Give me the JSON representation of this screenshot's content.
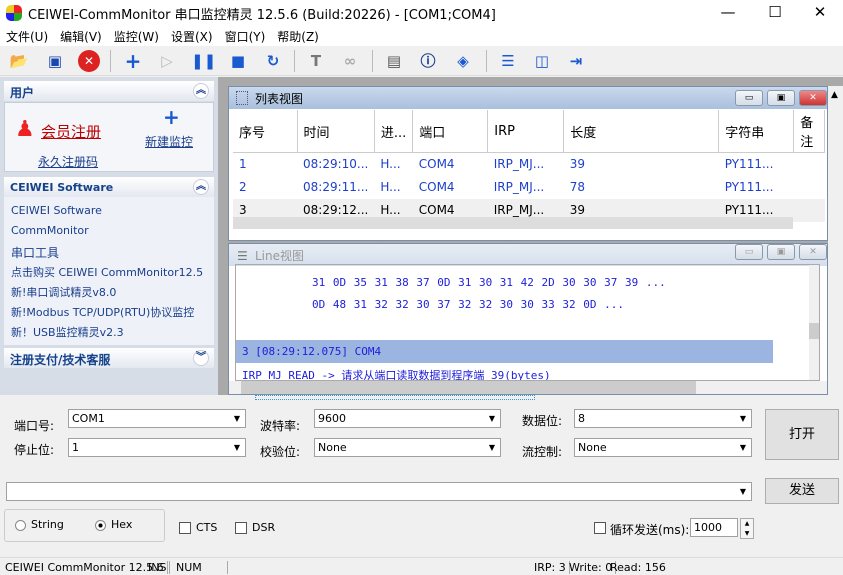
{
  "window": {
    "title": "CEIWEI-CommMonitor 串口监控精灵 12.5.6 (Build:20226) - [COM1;COM4]"
  },
  "menu": [
    "文件(U)",
    "编辑(V)",
    "监控(W)",
    "设置(X)",
    "窗口(Y)",
    "帮助(Z)"
  ],
  "toolbar": [
    "open-icon",
    "save-icon",
    "close-red-icon",
    "add-icon",
    "play-icon",
    "pause-icon",
    "stop-icon",
    "refresh-icon",
    "hammer-icon",
    "binoculars-icon",
    "device-icon",
    "info-icon",
    "book-icon",
    "split-horizontal-icon",
    "split-vertical-icon",
    "exit-icon"
  ],
  "sidebar": {
    "user": {
      "title": "用户",
      "register": "会员注册",
      "forever": "永久注册码",
      "new_monitor": "新建监控"
    },
    "software": {
      "title": "CEIWEI Software",
      "links": [
        "CEIWEI Software",
        "CommMonitor",
        "串口工具",
        "点击购买 CEIWEI CommMonitor12.5",
        "新!串口调试精灵v8.0",
        "新!Modbus TCP/UDP(RTU)协议监控",
        "新！USB监控精灵v2.3"
      ]
    },
    "support": {
      "title": "注册支付/技术客服"
    }
  },
  "list_view": {
    "title": "列表视图",
    "columns": [
      "序号",
      "时间",
      "进...",
      "端口",
      "IRP",
      "长度",
      "字符串",
      "备注"
    ],
    "rows": [
      [
        "1",
        "08:29:10...",
        "H...",
        "COM4",
        "IRP_MJ...",
        "39",
        "PY111...",
        ""
      ],
      [
        "2",
        "08:29:11...",
        "H...",
        "COM4",
        "IRP_MJ...",
        "78",
        "PY111...",
        ""
      ],
      [
        "3",
        "08:29:12...",
        "H...",
        "COM4",
        "IRP_MJ...",
        "39",
        "PY111...",
        ""
      ]
    ]
  },
  "line_view": {
    "title": "Line视图",
    "hex_lines": [
      "31 0D 35 31 38 37 0D 31 30 31 42 2D 30 30 37 39    ...",
      "0D 48 31 32 32 30 37 32 32 30 30 33 32 0D          ..."
    ],
    "selected": "3 [08:29:12.075] COM4",
    "irp_line": "IRP_MJ_READ -> 请求从端口读取数据到程序端 39(bytes)"
  },
  "config": {
    "port_label": "端口号:",
    "port": "COM1",
    "baud_label": "波特率:",
    "baud": "9600",
    "data_label": "数据位:",
    "data": "8",
    "stop_label": "停止位:",
    "stop": "1",
    "parity_label": "校验位:",
    "parity": "None",
    "flow_label": "流控制:",
    "flow": "None",
    "open": "打开",
    "send": "发送",
    "send_value": "",
    "string": "String",
    "hex": "Hex",
    "mode": "Hex",
    "cts": "CTS",
    "dsr": "DSR",
    "loop_label": "循环发送(ms):",
    "loop_ms": "1000",
    "loop_checked": false
  },
  "status": {
    "app": "CEIWEI CommMonitor 12.5.6",
    "ins": "INS",
    "num": "NUM",
    "irp": "IRP: 3",
    "write": "Write: 0",
    "read": "Read: 156"
  }
}
